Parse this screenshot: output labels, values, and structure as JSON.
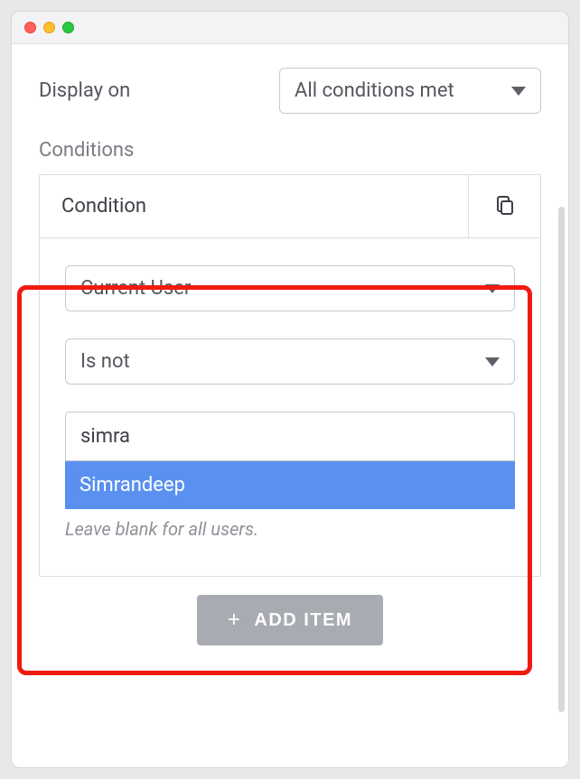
{
  "header": {
    "display_on_label": "Display on",
    "display_on_value": "All conditions met"
  },
  "conditions": {
    "section_label": "Conditions",
    "card_title": "Condition",
    "field_select": "Current User",
    "operator_select": "Is not",
    "value_input": "simra",
    "autocomplete_option": "Simrandeep",
    "hint": "Leave blank for all users."
  },
  "actions": {
    "add_item_label": "ADD ITEM"
  }
}
